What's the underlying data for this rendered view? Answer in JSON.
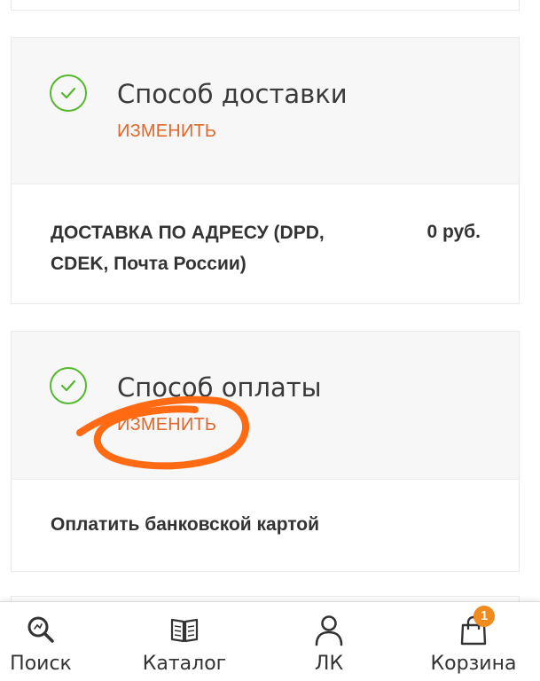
{
  "delivery": {
    "title": "Способ доставки",
    "change_label": "ИЗМЕНИТЬ",
    "option_name": "ДОСТАВКА ПО АДРЕСУ (DPD, CDEK, Почта России)",
    "option_price": "0 руб."
  },
  "payment": {
    "title": "Способ оплаты",
    "change_label": "ИЗМЕНИТЬ",
    "option_name": "Оплатить банковской картой"
  },
  "bottom_nav": {
    "items": [
      {
        "label": "Поиск",
        "icon": "search-icon"
      },
      {
        "label": "Каталог",
        "icon": "catalog-book-icon"
      },
      {
        "label": "ЛК",
        "icon": "user-icon"
      },
      {
        "label": "Корзина",
        "icon": "shopping-bag-icon"
      }
    ],
    "cart_count": "1"
  },
  "colors": {
    "accent": "#e0662a",
    "check_green": "#55b82f",
    "annotation_orange": "#ff6a13",
    "badge": "#f08b1d"
  }
}
